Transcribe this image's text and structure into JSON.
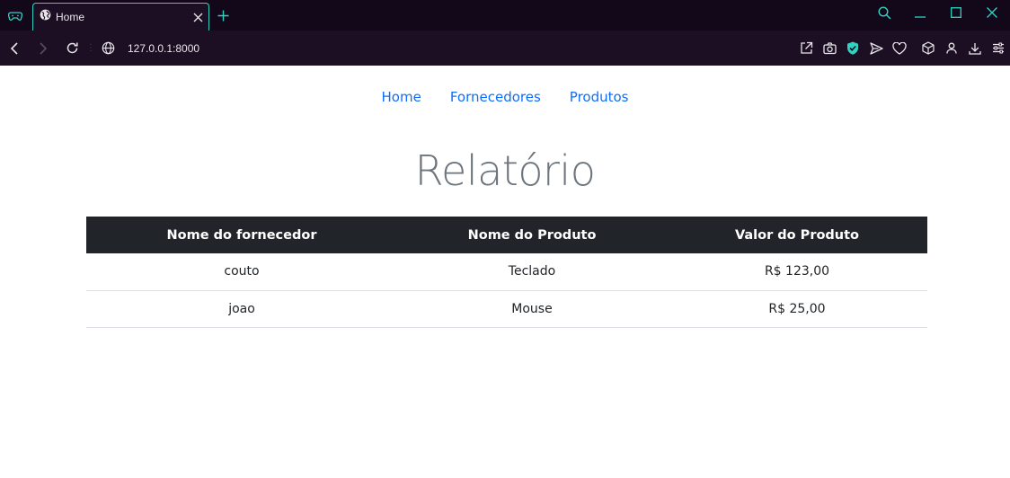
{
  "browser": {
    "tab": {
      "title": "Home"
    },
    "address": {
      "url": "127.0.0.1:8000"
    },
    "accent": "#2fd3c2"
  },
  "nav": {
    "links": [
      "Home",
      "Fornecedores",
      "Produtos"
    ]
  },
  "page": {
    "title": "Relatório"
  },
  "table": {
    "headers": [
      "Nome do fornecedor",
      "Nome do Produto",
      "Valor do Produto"
    ],
    "rows": [
      [
        "couto",
        "Teclado",
        "R$ 123,00"
      ],
      [
        "joao",
        "Mouse",
        "R$ 25,00"
      ]
    ]
  }
}
